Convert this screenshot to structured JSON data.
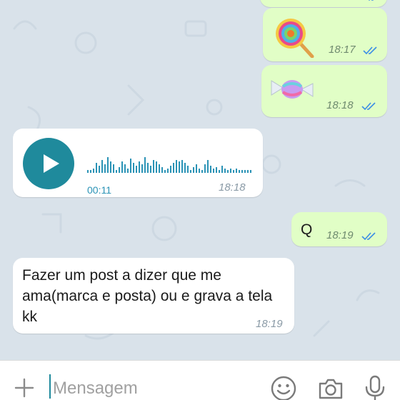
{
  "messages": [
    {
      "type": "sticker",
      "direction": "out",
      "emoji": "🍭",
      "emoji_name": "lollipop-emoji",
      "time": "18:17",
      "status": "read"
    },
    {
      "type": "sticker",
      "direction": "out",
      "emoji": "🍬",
      "emoji_name": "candy-emoji",
      "time": "18:18",
      "status": "read"
    },
    {
      "type": "voice",
      "direction": "in",
      "duration": "00:11",
      "time": "18:18"
    },
    {
      "type": "text",
      "direction": "out",
      "text": "Q",
      "time": "18:19",
      "status": "read"
    },
    {
      "type": "text",
      "direction": "in",
      "text": "Fazer um post a dizer que me ama(marca e posta) ou e grava a tela kk",
      "time": "18:19"
    }
  ],
  "input": {
    "placeholder": "Mensagem",
    "value": ""
  },
  "icons": [
    "plus-icon",
    "emoji-icon",
    "camera-icon",
    "microphone-icon",
    "read-ticks-icon",
    "play-icon"
  ],
  "colors": {
    "outgoing_bubble": "#e1fec6",
    "incoming_bubble": "#ffffff",
    "accent": "#1f8a9c",
    "read_ticks": "#3a8ee6"
  }
}
